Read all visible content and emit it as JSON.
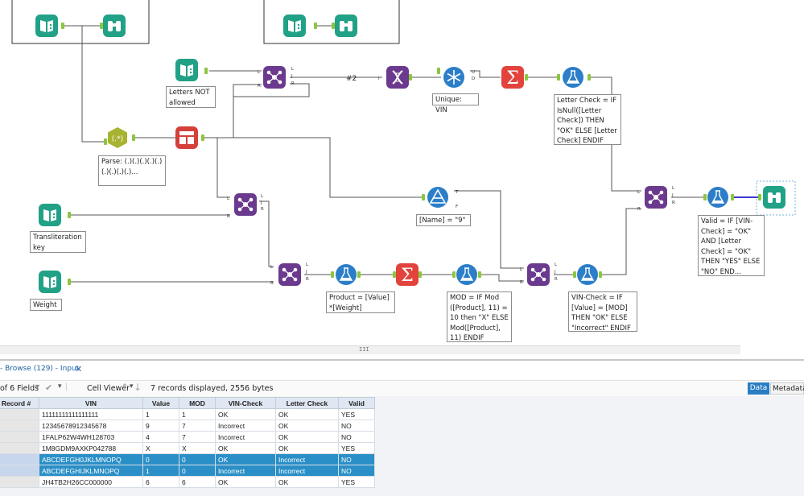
{
  "canvas": {
    "annotations": {
      "letters_not_allowed": "Letters NOT allowed",
      "parse": "Parse: (.)(.)(.)(.)(.)(.)(.)(.)(.)...",
      "transliteration_key": "Transliteration key",
      "weight": "Weight",
      "unique_vin": "Unique: VIN",
      "letter_check": "Letter Check = IF IsNull([Letter Check]) THEN \"OK\" ELSE [Letter Check] ENDIF",
      "name_filter": "[Name] = \"9\"",
      "valid": "Valid = IF [VIN-Check] = \"OK\" AND [Letter Check] = \"OK\" THEN \"YES\" ELSE \"NO\" END...",
      "product": "Product = [Value] *[Weight]",
      "mod": "MOD = IF Mod ([Product], 11) = 10 then \"X\" ELSE Mod([Product], 11) ENDIF",
      "vin_check": "VIN-Check = IF [Value] = [MOD] THEN \"OK\" ELSE \"Incorrect\" ENDIF",
      "connection_label": "#2"
    },
    "scroll_grip": "III"
  },
  "results": {
    "title": "- Browse (129) - Input",
    "fields_label": "of 6 Fields",
    "viewer_label": "Cell Viewer",
    "summary": "7 records displayed, 2556 bytes",
    "tab_data": "Data",
    "tab_metadata": "Metadata",
    "columns": [
      "Record #",
      "VIN",
      "Value",
      "MOD",
      "VIN-Check",
      "Letter Check",
      "Valid"
    ],
    "rows": [
      [
        "1",
        "11111111111111111",
        "1",
        "1",
        "OK",
        "OK",
        "YES"
      ],
      [
        "2",
        "12345678912345678",
        "9",
        "7",
        "Incorrect",
        "OK",
        "NO"
      ],
      [
        "3",
        "1FALP62W4WH128703",
        "4",
        "7",
        "Incorrect",
        "OK",
        "NO"
      ],
      [
        "4",
        "1M8GDM9AXKP042788",
        "X",
        "X",
        "OK",
        "OK",
        "YES"
      ],
      [
        "5",
        "ABCDEFGH0JKLMNOPQ",
        "0",
        "0",
        "OK",
        "Incorrect",
        "NO"
      ],
      [
        "6",
        "ABCDEFGHIJKLMNOPQ",
        "1",
        "0",
        "Incorrect",
        "Incorrect",
        "NO"
      ],
      [
        "7",
        "JH4TB2H26CC000000",
        "6",
        "6",
        "OK",
        "OK",
        "YES"
      ]
    ],
    "selected_rows": [
      4,
      5
    ]
  },
  "colors": {
    "input_tool": "#21a186",
    "join_tool": "#6b3a8e",
    "formula_tool": "#2c7ec8",
    "summarize_tool": "#e2433c",
    "selection": "#2a8fc7"
  }
}
